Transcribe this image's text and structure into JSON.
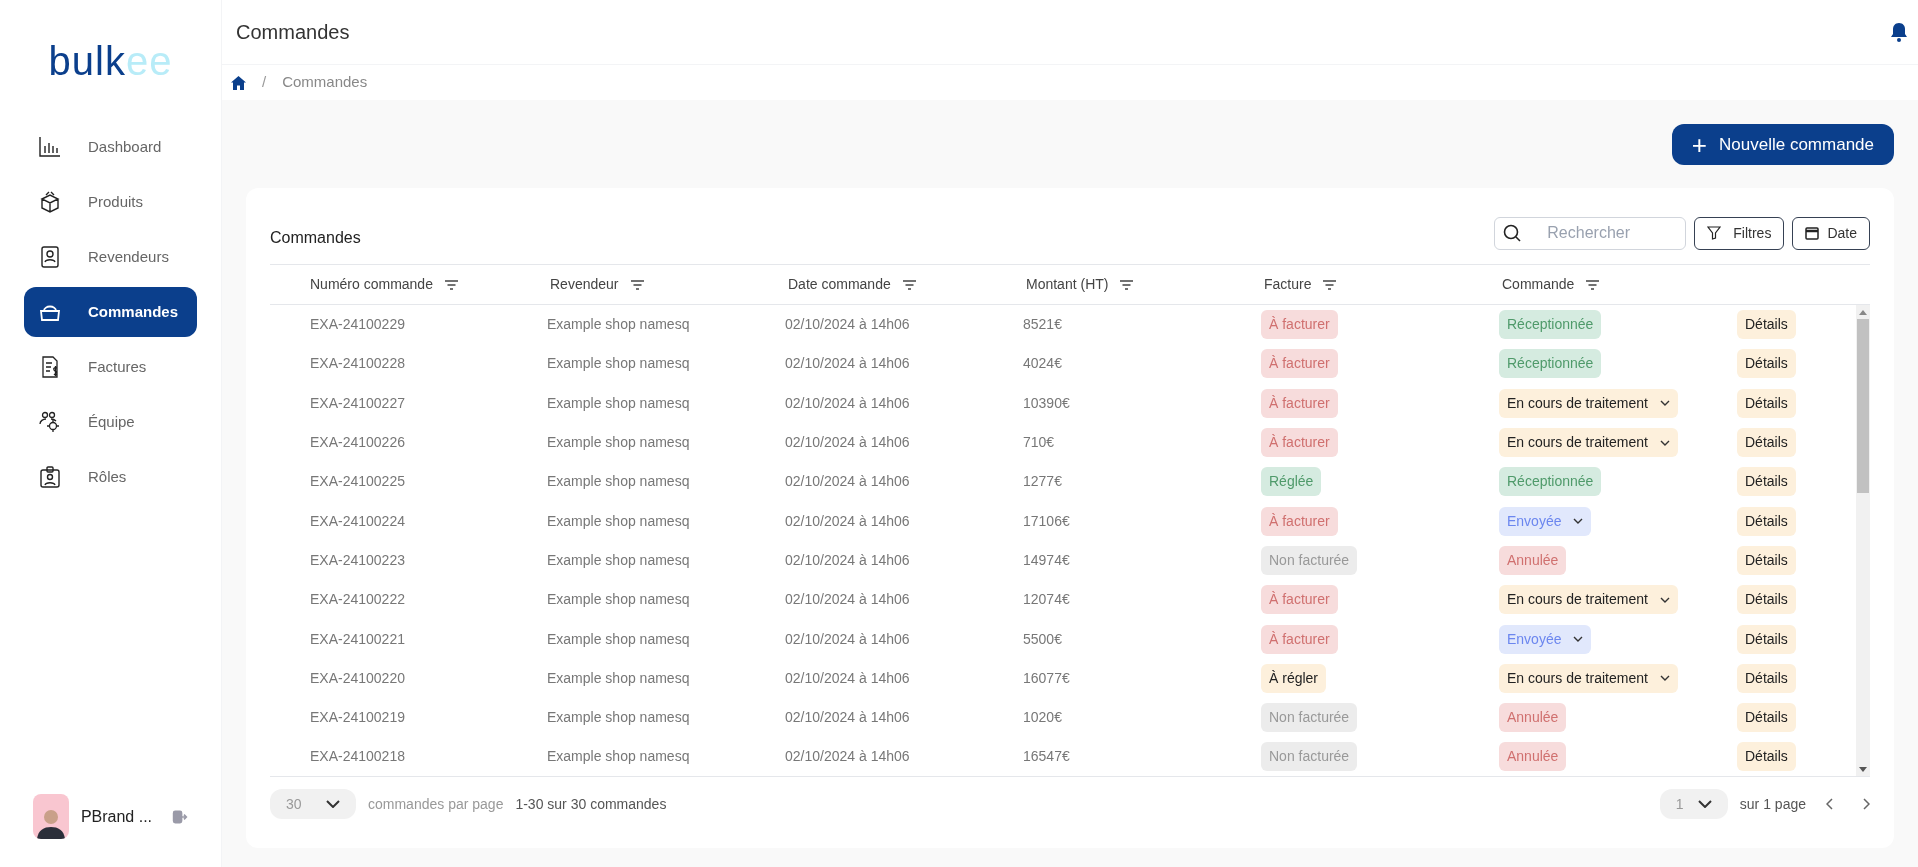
{
  "logo": {
    "main": "bulk",
    "accent": "ee"
  },
  "sidebar": {
    "items": [
      {
        "label": "Dashboard",
        "selected": false
      },
      {
        "label": "Produits",
        "selected": false
      },
      {
        "label": "Revendeurs",
        "selected": false
      },
      {
        "label": "Commandes",
        "selected": true
      },
      {
        "label": "Factures",
        "selected": false
      },
      {
        "label": "Équipe",
        "selected": false
      },
      {
        "label": "Rôles",
        "selected": false
      }
    ],
    "user": {
      "name": "PBrand ..."
    }
  },
  "header": {
    "title": "Commandes"
  },
  "breadcrumb": {
    "separator": "/",
    "items": [
      "Commandes"
    ]
  },
  "new_button": {
    "icon": "+",
    "label": "Nouvelle commande"
  },
  "card": {
    "title": "Commandes",
    "search": {
      "placeholder": "Rechercher"
    },
    "filters_button": "Filtres",
    "date_button": "Date"
  },
  "table": {
    "columns": [
      "Numéro commande",
      "Revendeur",
      "Date commande",
      "Montant (HT)",
      "Facture",
      "Commande"
    ],
    "rows": [
      {
        "number": "EXA-24100229",
        "reseller": "Example shop namesq",
        "date": "02/10/2024 à 14h06",
        "amount": "8521€",
        "invoice": {
          "kind": "to_invoice",
          "label": "À facturer"
        },
        "order": {
          "kind": "received",
          "label": "Réceptionnée"
        },
        "action": "Détails"
      },
      {
        "number": "EXA-24100228",
        "reseller": "Example shop namesq",
        "date": "02/10/2024 à 14h06",
        "amount": "4024€",
        "invoice": {
          "kind": "to_invoice",
          "label": "À facturer"
        },
        "order": {
          "kind": "received",
          "label": "Réceptionnée"
        },
        "action": "Détails"
      },
      {
        "number": "EXA-24100227",
        "reseller": "Example shop namesq",
        "date": "02/10/2024 à 14h06",
        "amount": "10390€",
        "invoice": {
          "kind": "to_invoice",
          "label": "À facturer"
        },
        "order": {
          "kind": "processing",
          "label": "En cours de traitement"
        },
        "action": "Détails"
      },
      {
        "number": "EXA-24100226",
        "reseller": "Example shop namesq",
        "date": "02/10/2024 à 14h06",
        "amount": "710€",
        "invoice": {
          "kind": "to_invoice",
          "label": "À facturer"
        },
        "order": {
          "kind": "processing",
          "label": "En cours de traitement"
        },
        "action": "Détails"
      },
      {
        "number": "EXA-24100225",
        "reseller": "Example shop namesq",
        "date": "02/10/2024 à 14h06",
        "amount": "1277€",
        "invoice": {
          "kind": "paid",
          "label": "Réglée"
        },
        "order": {
          "kind": "received",
          "label": "Réceptionnée"
        },
        "action": "Détails"
      },
      {
        "number": "EXA-24100224",
        "reseller": "Example shop namesq",
        "date": "02/10/2024 à 14h06",
        "amount": "17106€",
        "invoice": {
          "kind": "to_invoice",
          "label": "À facturer"
        },
        "order": {
          "kind": "sent",
          "label": "Envoyée"
        },
        "action": "Détails"
      },
      {
        "number": "EXA-24100223",
        "reseller": "Example shop namesq",
        "date": "02/10/2024 à 14h06",
        "amount": "14974€",
        "invoice": {
          "kind": "not_invoiced",
          "label": "Non facturée"
        },
        "order": {
          "kind": "cancelled",
          "label": "Annulée"
        },
        "action": "Détails"
      },
      {
        "number": "EXA-24100222",
        "reseller": "Example shop namesq",
        "date": "02/10/2024 à 14h06",
        "amount": "12074€",
        "invoice": {
          "kind": "to_invoice",
          "label": "À facturer"
        },
        "order": {
          "kind": "processing",
          "label": "En cours de traitement"
        },
        "action": "Détails"
      },
      {
        "number": "EXA-24100221",
        "reseller": "Example shop namesq",
        "date": "02/10/2024 à 14h06",
        "amount": "5500€",
        "invoice": {
          "kind": "to_invoice",
          "label": "À facturer"
        },
        "order": {
          "kind": "sent",
          "label": "Envoyée"
        },
        "action": "Détails"
      },
      {
        "number": "EXA-24100220",
        "reseller": "Example shop namesq",
        "date": "02/10/2024 à 14h06",
        "amount": "16077€",
        "invoice": {
          "kind": "to_pay",
          "label": "À régler"
        },
        "order": {
          "kind": "processing",
          "label": "En cours de traitement"
        },
        "action": "Détails"
      },
      {
        "number": "EXA-24100219",
        "reseller": "Example shop namesq",
        "date": "02/10/2024 à 14h06",
        "amount": "1020€",
        "invoice": {
          "kind": "not_invoiced",
          "label": "Non facturée"
        },
        "order": {
          "kind": "cancelled",
          "label": "Annulée"
        },
        "action": "Détails"
      },
      {
        "number": "EXA-24100218",
        "reseller": "Example shop namesq",
        "date": "02/10/2024 à 14h06",
        "amount": "16547€",
        "invoice": {
          "kind": "not_invoiced",
          "label": "Non facturée"
        },
        "order": {
          "kind": "cancelled",
          "label": "Annulée"
        },
        "action": "Détails"
      }
    ]
  },
  "pagination": {
    "per_page": "30",
    "per_page_label": "commandes par page",
    "range": "1-30 sur 30 commandes",
    "page": "1",
    "page_total": "sur 1 page"
  }
}
